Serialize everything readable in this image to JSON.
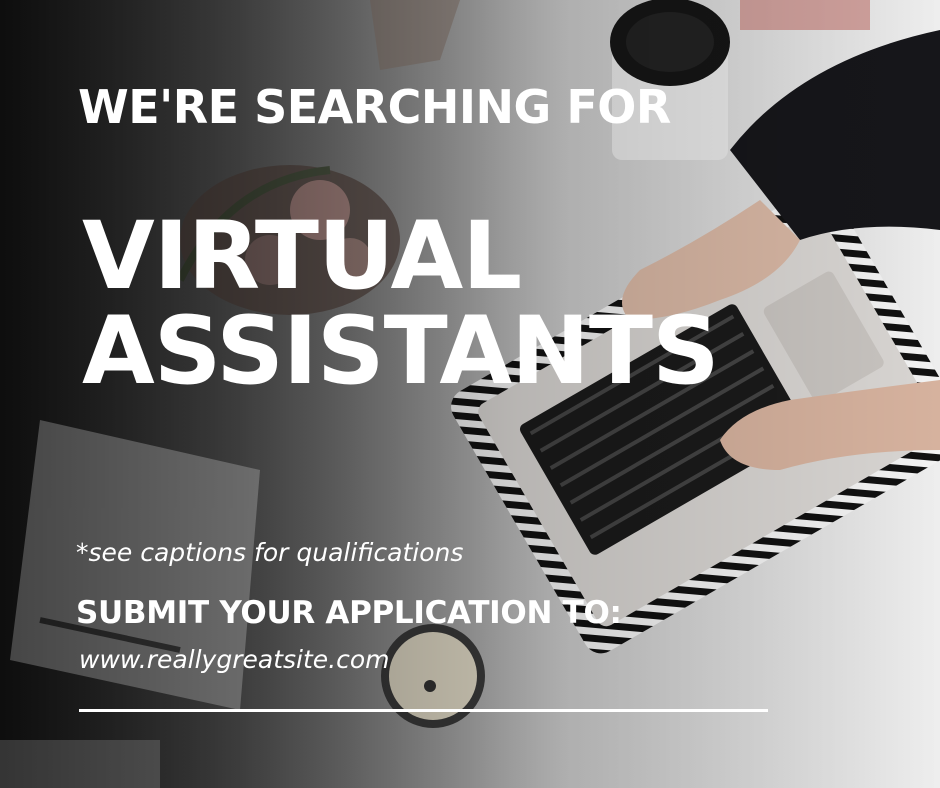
{
  "headline": {
    "eyebrow": "WE'RE SEARCHING FOR",
    "title_line1": "VIRTUAL",
    "title_line2": "ASSISTANTS"
  },
  "note": "*see captions for qualifications",
  "cta": {
    "label": "SUBMIT YOUR APPLICATION TO:",
    "url": "www.reallygreatsite.com"
  }
}
